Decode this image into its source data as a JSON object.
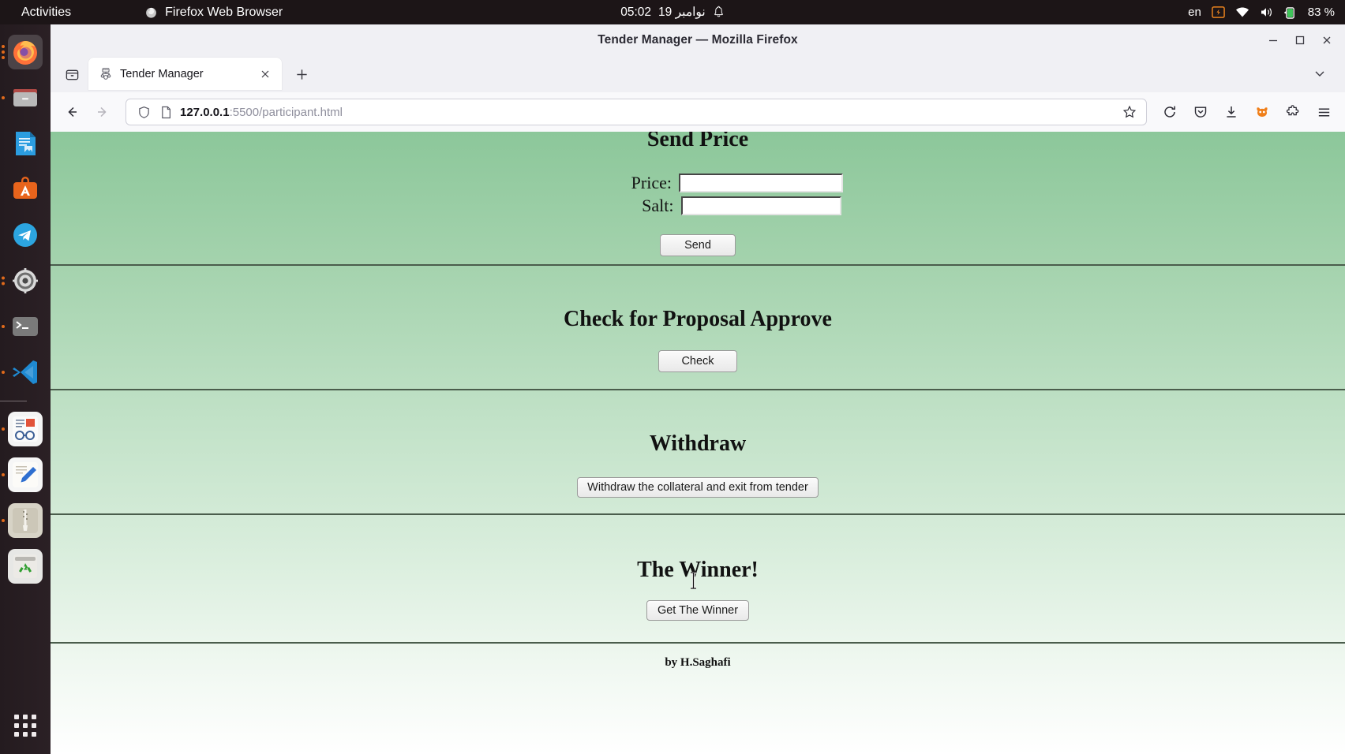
{
  "desktop": {
    "activities_label": "Activities",
    "app_menu_label": "Firefox Web Browser",
    "clock": "05:02",
    "date": "نوامبر 19",
    "keyboard_layout": "en",
    "battery_percent": "83 %",
    "dock_items": [
      {
        "name": "firefox",
        "label": "Firefox Web Browser",
        "dots": 3,
        "running": true
      },
      {
        "name": "files",
        "label": "Files",
        "dots": 1,
        "running": false
      },
      {
        "name": "libreoffice-writer",
        "label": "LibreOffice Writer",
        "dots": 0,
        "running": false
      },
      {
        "name": "ubuntu-software",
        "label": "Ubuntu Software",
        "dots": 0,
        "running": false
      },
      {
        "name": "telegram",
        "label": "Telegram",
        "dots": 0,
        "running": false
      },
      {
        "name": "settings",
        "label": "Settings",
        "dots": 2,
        "running": false
      },
      {
        "name": "terminal",
        "label": "Terminal",
        "dots": 1,
        "running": false
      },
      {
        "name": "vscode",
        "label": "Visual Studio Code",
        "dots": 1,
        "running": false
      },
      {
        "name": "document-viewer",
        "label": "Document Viewer",
        "dots": 1,
        "running": false
      },
      {
        "name": "text-editor",
        "label": "Text Editor",
        "dots": 1,
        "running": false
      },
      {
        "name": "archive-manager",
        "label": "Archive Manager",
        "dots": 1,
        "running": false
      },
      {
        "name": "trash",
        "label": "Trash",
        "dots": 0,
        "running": false
      }
    ],
    "show_apps_label": "Show Applications"
  },
  "browser": {
    "window_title": "Tender Manager — Mozilla Firefox",
    "tab": {
      "title": "Tender Manager",
      "close_label": "✕"
    },
    "new_tab_label": "+",
    "url": {
      "host": "127.0.0.1",
      "path": ":5500/participant.html"
    },
    "window_controls": {
      "minimize": "—",
      "maximize": "▢",
      "close": "✕"
    }
  },
  "page": {
    "sections": [
      {
        "id": "send-price",
        "title": "Send Price",
        "fields": [
          {
            "label": "Price:",
            "value": "",
            "placeholder": ""
          },
          {
            "label": "Salt:",
            "value": "",
            "placeholder": ""
          }
        ],
        "button": "Send"
      },
      {
        "id": "check-proposal",
        "title": "Check for Proposal Approve",
        "button": "Check"
      },
      {
        "id": "withdraw",
        "title": "Withdraw",
        "button": "Withdraw the collateral and exit from tender"
      },
      {
        "id": "winner",
        "title": "The Winner!",
        "button": "Get The Winner"
      }
    ],
    "credit": "by H.Saghafi",
    "colors": {
      "gradient_top": "#8cc79a",
      "gradient_bottom": "#ffffff",
      "divider": "#4a5d4c"
    }
  }
}
